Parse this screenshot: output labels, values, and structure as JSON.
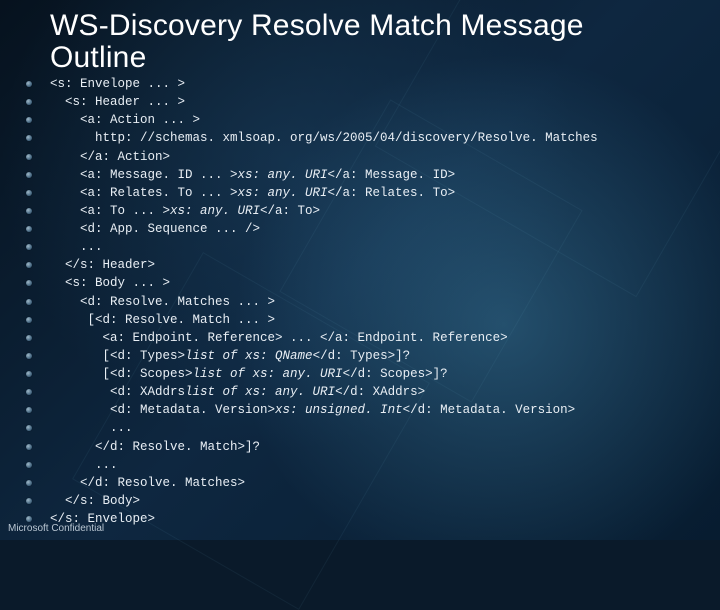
{
  "title_line1": "WS-Discovery Resolve Match Message",
  "title_line2": "Outline",
  "footer": "Microsoft Confidential",
  "lines": [
    {
      "text": "<s: Envelope ... >"
    },
    {
      "text": "  <s: Header ... >"
    },
    {
      "text": "    <a: Action ... >"
    },
    {
      "text": "      http: //schemas. xmlsoap. org/ws/2005/04/discovery/Resolve. Matches"
    },
    {
      "text": "    </a: Action>"
    },
    {
      "text": "    <a: Message. ID ... >",
      "italic": "xs: any. URI",
      "after": "</a: Message. ID>"
    },
    {
      "text": "    <a: Relates. To ... >",
      "italic": "xs: any. URI",
      "after": "</a: Relates. To>"
    },
    {
      "text": "    <a: To ... >",
      "italic": "xs: any. URI",
      "after": "</a: To>"
    },
    {
      "text": "    <d: App. Sequence ... />"
    },
    {
      "text": "    ..."
    },
    {
      "text": "  </s: Header>"
    },
    {
      "text": "  <s: Body ... >"
    },
    {
      "text": "    <d: Resolve. Matches ... >"
    },
    {
      "text": "     [<d: Resolve. Match ... >"
    },
    {
      "text": "       <a: Endpoint. Reference> ... </a: Endpoint. Reference>"
    },
    {
      "text": "       [<d: Types>",
      "italic": "list of xs: QName",
      "after": "</d: Types>]?"
    },
    {
      "text": "       [<d: Scopes>",
      "italic": "list of xs: any. URI",
      "after": "</d: Scopes>]?"
    },
    {
      "text": "        <d: XAddrs",
      "italic": "list of xs: any. URI",
      "after": "</d: XAddrs>"
    },
    {
      "text": "        <d: Metadata. Version>",
      "italic": "xs: unsigned. Int",
      "after": "</d: Metadata. Version>"
    },
    {
      "text": "        ..."
    },
    {
      "text": "      </d: Resolve. Match>]?"
    },
    {
      "text": "      ..."
    },
    {
      "text": "    </d: Resolve. Matches>"
    },
    {
      "text": "  </s: Body>"
    },
    {
      "text": "</s: Envelope>"
    }
  ]
}
